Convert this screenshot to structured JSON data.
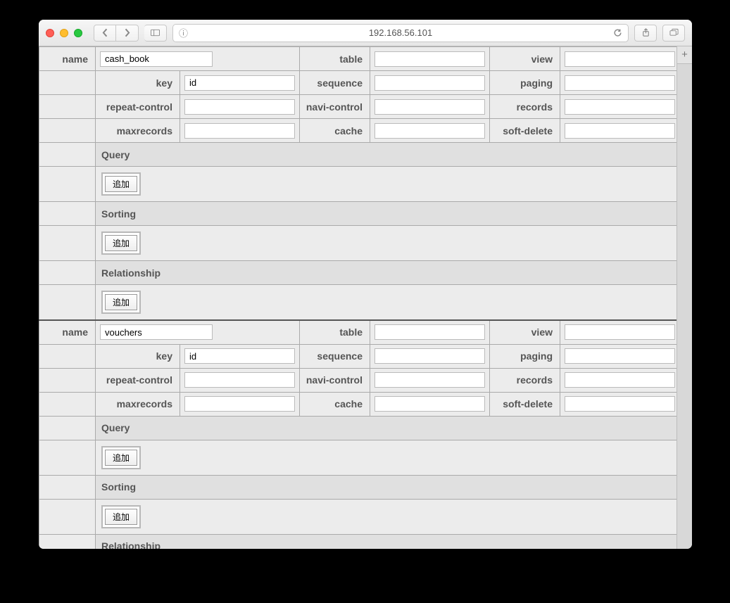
{
  "browser": {
    "address": "192.168.56.101"
  },
  "labels": {
    "name": "name",
    "table": "table",
    "view": "view",
    "key": "key",
    "sequence": "sequence",
    "paging": "paging",
    "repeat_control": "repeat-control",
    "navi_control": "navi-control",
    "records": "records",
    "maxrecords": "maxrecords",
    "cache": "cache",
    "soft_delete": "soft-delete"
  },
  "section_headers": {
    "query": "Query",
    "sorting": "Sorting",
    "relationship": "Relationship"
  },
  "add_button_label": "追加",
  "contexts": [
    {
      "name": "cash_book",
      "table": "",
      "view": "",
      "key": "id",
      "sequence": "",
      "paging": "",
      "repeat_control": "",
      "navi_control": "",
      "records": "",
      "maxrecords": "",
      "cache": "",
      "soft_delete": ""
    },
    {
      "name": "vouchers",
      "table": "",
      "view": "",
      "key": "id",
      "sequence": "",
      "paging": "",
      "repeat_control": "",
      "navi_control": "",
      "records": "",
      "maxrecords": "",
      "cache": "",
      "soft_delete": ""
    }
  ]
}
